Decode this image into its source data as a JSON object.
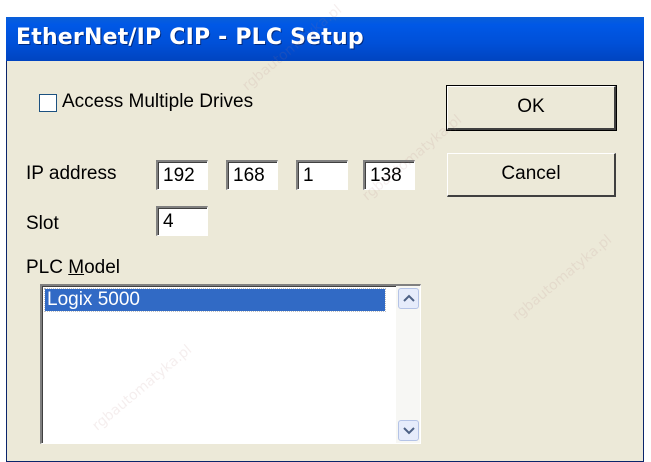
{
  "dialog": {
    "title": "EtherNet/IP CIP - PLC Setup"
  },
  "access_multiple": {
    "label": "Access Multiple Drives",
    "checked": false
  },
  "ip": {
    "label": "IP address",
    "octets": [
      "192",
      "168",
      "1",
      "138"
    ]
  },
  "slot": {
    "label": "Slot",
    "value": "4"
  },
  "plc_model": {
    "label_prefix": "PLC ",
    "label_mnemonic": "M",
    "label_rest": "odel",
    "items": [
      "Logix 5000"
    ],
    "selected_index": 0
  },
  "buttons": {
    "ok": "OK",
    "cancel": "Cancel"
  },
  "watermark": {
    "text": "rgbautomatyka.pl"
  },
  "icons": {
    "scroll_up": "scroll-up-arrow-icon",
    "scroll_down": "scroll-down-arrow-icon"
  }
}
